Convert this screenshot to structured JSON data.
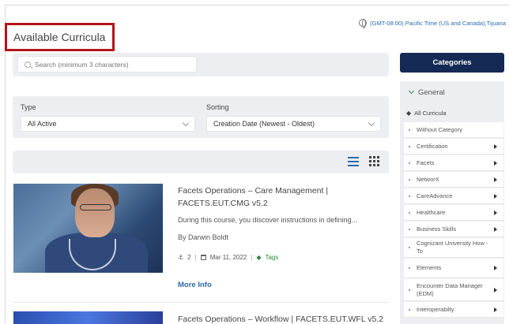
{
  "header": {
    "title": "Available Curricula",
    "timezone": "(GMT-08:00) Pacific Time (US and Canada),Tijuana"
  },
  "search": {
    "placeholder": "Search (minimum 3 characters)"
  },
  "filters": {
    "type_label": "Type",
    "type_value": "All Active",
    "sorting_label": "Sorting",
    "sorting_value": "Creation Date (Newest - Oldest)"
  },
  "courses": [
    {
      "title_line1": "Facets Operations – Care Management |",
      "title_line2": "FACETS.EUT.CMG v5.2",
      "description": "During this course, you discover instructions in defining...",
      "author": "By Darwin Boldt",
      "users": "2",
      "date": "Mar 11, 2022",
      "tags_label": "Tags",
      "more_info": "More Info"
    },
    {
      "title_line1": "Facets Operations – Workflow | FACETS.EUT.WFL v5.2"
    }
  ],
  "sidebar": {
    "categories_button": "Categories",
    "group_label": "General",
    "all_curricula": "All Curricula",
    "items": [
      {
        "label": "Without Category",
        "has_children": false
      },
      {
        "label": "Certification",
        "has_children": true
      },
      {
        "label": "Facets",
        "has_children": true
      },
      {
        "label": "NetworX",
        "has_children": true
      },
      {
        "label": "CareAdvance",
        "has_children": true
      },
      {
        "label": "Healthcare",
        "has_children": true
      },
      {
        "label": "Business Skills",
        "has_children": true
      },
      {
        "label": "Cognizant University How - To",
        "has_children": false
      },
      {
        "label": "Elements",
        "has_children": true
      },
      {
        "label": "Encounter Data Manager (EDM)",
        "has_children": true
      },
      {
        "label": "Interoperabilty",
        "has_children": true
      }
    ]
  },
  "colors": {
    "accent": "#2a6ab0",
    "sidebar_button": "#142a54",
    "title_outline": "#b3141b",
    "tags": "#2e8b3a"
  }
}
